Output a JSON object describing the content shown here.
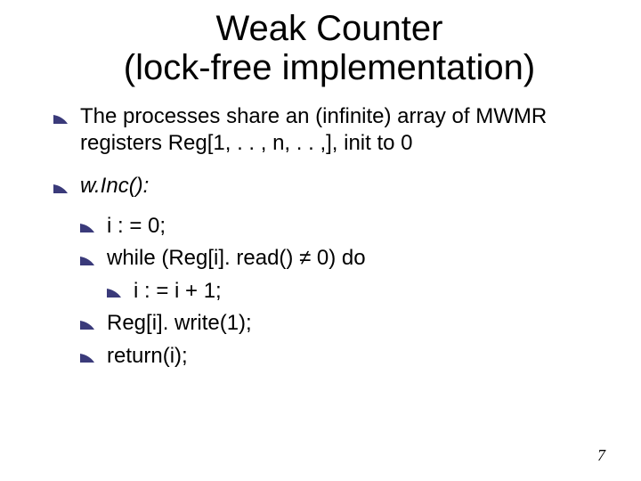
{
  "title_line1": "Weak Counter",
  "title_line2": "(lock-free implementation)",
  "body": {
    "p1": "The processes share an (infinite) array of MWMR registers Reg[1, . . , n, . . ,], init to 0",
    "func": "w.Inc():",
    "code": {
      "l1": "i : = 0;",
      "l2": "while (Reg[i]. read() ≠ 0) do",
      "l3": "i : = i + 1;",
      "l4": "Reg[i]. write(1);",
      "l5": "return(i);"
    }
  },
  "pagenum": "7"
}
